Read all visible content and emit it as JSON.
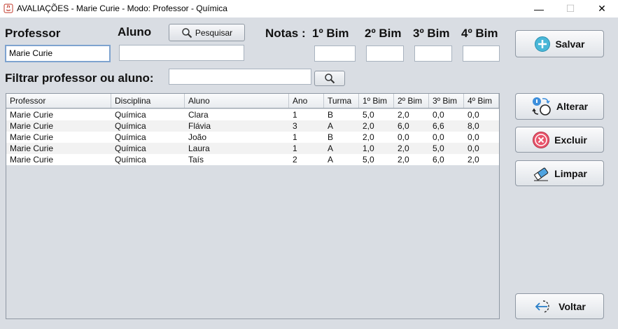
{
  "window": {
    "title": "AVALIAÇÕES - Marie Curie - Modo: Professor - Química",
    "minimize": "—",
    "maximize": "☐",
    "close": "✕"
  },
  "form": {
    "professor_label": "Professor",
    "aluno_label": "Aluno",
    "pesquisar_label": "Pesquisar",
    "notas_label": "Notas :",
    "bim1_label": "1º Bim",
    "bim2_label": "2º Bim",
    "bim3_label": "3º Bim",
    "bim4_label": "4º Bim",
    "professor_value": "Marie Curie",
    "aluno_value": "",
    "bim1_value": "",
    "bim2_value": "",
    "bim3_value": "",
    "bim4_value": "",
    "filtrar_label": "Filtrar professor ou aluno:",
    "filtrar_value": ""
  },
  "buttons": {
    "salvar": "Salvar",
    "alterar": "Alterar",
    "excluir": "Excluir",
    "limpar": "Limpar",
    "voltar": "Voltar"
  },
  "table": {
    "columns": [
      "Professor",
      "Disciplina",
      "Aluno",
      "Ano",
      "Turma",
      "1º Bim",
      "2º Bim",
      "3º Bim",
      "4º Bim"
    ],
    "rows": [
      [
        "Marie Curie",
        "Química",
        "Clara",
        "1",
        "B",
        "5,0",
        "2,0",
        "0,0",
        "0,0"
      ],
      [
        "Marie Curie",
        "Química",
        "Flávia",
        "3",
        "A",
        "2,0",
        "6,0",
        "6,6",
        "8,0"
      ],
      [
        "Marie Curie",
        "Química",
        "João",
        "1",
        "B",
        "2,0",
        "0,0",
        "0,0",
        "0,0"
      ],
      [
        "Marie Curie",
        "Química",
        "Laura",
        "1",
        "A",
        "1,0",
        "2,0",
        "5,0",
        "0,0"
      ],
      [
        "Marie Curie",
        "Química",
        "Taís",
        "2",
        "A",
        "5,0",
        "2,0",
        "6,0",
        "2,0"
      ]
    ]
  },
  "icons": {
    "app": "java-icon",
    "search": "magnifier-icon",
    "salvar": "plus-circle-icon",
    "alterar": "swap-icon",
    "excluir": "x-circle-icon",
    "limpar": "eraser-icon",
    "voltar": "back-arrow-icon"
  }
}
